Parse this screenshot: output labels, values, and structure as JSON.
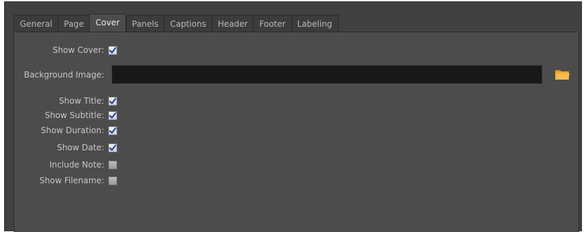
{
  "tabs": [
    {
      "label": "General",
      "active": false
    },
    {
      "label": "Page",
      "active": false
    },
    {
      "label": "Cover",
      "active": true
    },
    {
      "label": "Panels",
      "active": false
    },
    {
      "label": "Captions",
      "active": false
    },
    {
      "label": "Header",
      "active": false
    },
    {
      "label": "Footer",
      "active": false
    },
    {
      "label": "Labeling",
      "active": false
    }
  ],
  "cover": {
    "show_cover": {
      "label": "Show Cover:",
      "checked": true
    },
    "background_image": {
      "label": "Background Image:",
      "value": "",
      "browse_icon": "folder-icon"
    },
    "show_title": {
      "label": "Show Title:",
      "checked": true
    },
    "show_subtitle": {
      "label": "Show Subtitle:",
      "checked": true
    },
    "show_duration": {
      "label": "Show Duration:",
      "checked": true
    },
    "show_date": {
      "label": "Show Date:",
      "checked": true
    },
    "include_note": {
      "label": "Include Note:",
      "checked": false
    },
    "show_filename": {
      "label": "Show Filename:",
      "checked": false
    }
  },
  "colors": {
    "check_mark": "#1f3fb0",
    "folder": "#f0a531",
    "panel_bg": "#4c4c4c",
    "field_bg": "#181818"
  }
}
